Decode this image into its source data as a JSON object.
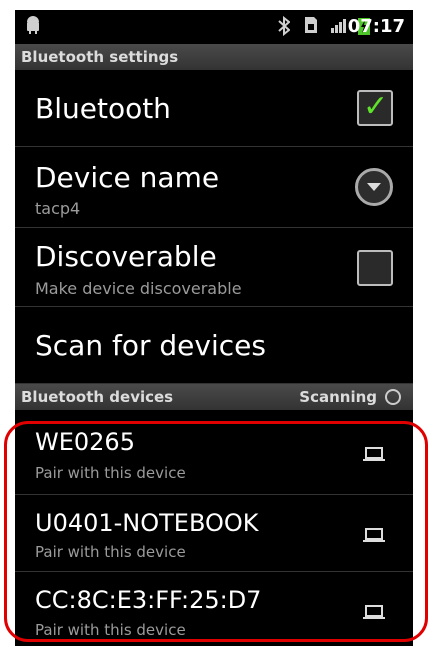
{
  "status_bar": {
    "time": "07:17",
    "icons": [
      "android-icon",
      "bluetooth-icon",
      "sim-icon",
      "signal-icon",
      "battery-icon"
    ]
  },
  "header": {
    "title": "Bluetooth settings"
  },
  "settings": {
    "bluetooth": {
      "label": "Bluetooth",
      "checked": true
    },
    "device_name": {
      "label": "Device name",
      "value": "tacp4"
    },
    "discoverable": {
      "label": "Discoverable",
      "summary": "Make device discoverable",
      "checked": false
    },
    "scan": {
      "label": "Scan for devices"
    }
  },
  "devices_section": {
    "title": "Bluetooth devices",
    "status": "Scanning"
  },
  "devices": [
    {
      "name": "WE0265",
      "action": "Pair with this device",
      "icon": "laptop-icon"
    },
    {
      "name": "U0401-NOTEBOOK",
      "action": "Pair with this device",
      "icon": "laptop-icon"
    },
    {
      "name": "CC:8C:E3:FF:25:D7",
      "action": "Pair with this device",
      "icon": "laptop-icon"
    }
  ],
  "colors": {
    "check_green": "#5ee22a",
    "highlight_red": "#e00000"
  }
}
